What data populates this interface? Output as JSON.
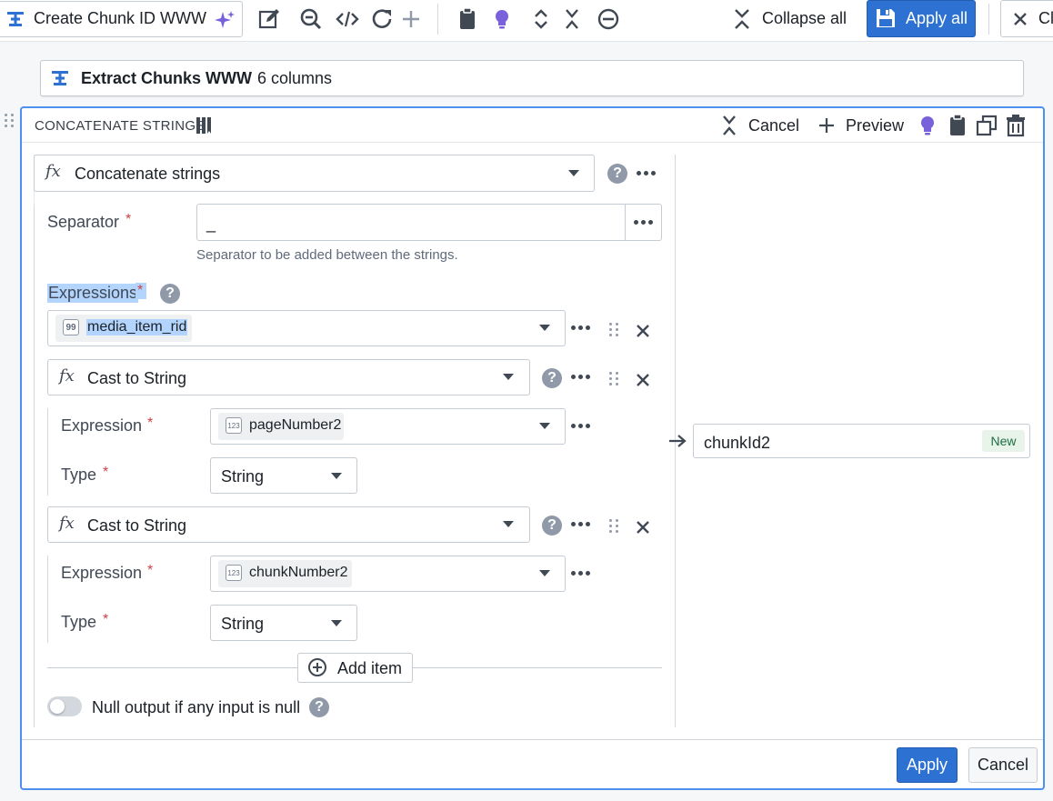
{
  "toolbar": {
    "board_name": "Create Chunk ID WWW",
    "collapse_all": "Collapse all",
    "apply_all": "Apply all",
    "close_partial": "Cl"
  },
  "input": {
    "name": "Extract Chunks WWW",
    "columns": "6 columns"
  },
  "panel": {
    "title": "CONCATENATE STRINGS",
    "cancel": "Cancel",
    "preview": "Preview",
    "function_name": "Concatenate strings",
    "separator_label": "Separator",
    "separator_value": "_",
    "separator_help": "Separator to be added between the strings.",
    "expressions_label": "Expressions",
    "required_mark": "*",
    "help_mark": "?",
    "expressions": {
      "column1": "media_item_rid",
      "cast1": {
        "function": "Cast to String",
        "expression_label": "Expression",
        "expression_value": "pageNumber2",
        "type_label": "Type",
        "type_value": "String"
      },
      "cast2": {
        "function": "Cast to String",
        "expression_label": "Expression",
        "expression_value": "chunkNumber2",
        "type_label": "Type",
        "type_value": "String"
      }
    },
    "add_item": "Add item",
    "null_output": "Null output if any input is null",
    "null_output_enabled": false,
    "output_column": "chunkId2",
    "output_badge": "New",
    "apply": "Apply",
    "cancel_footer": "Cancel",
    "type_badge": "123",
    "quote_badge": "99"
  },
  "colors": {
    "primary": "#2d72d2",
    "panel_border": "#4c90f0",
    "intent_purple": "#7961db",
    "selection_highlight": "#b3d4fc"
  }
}
